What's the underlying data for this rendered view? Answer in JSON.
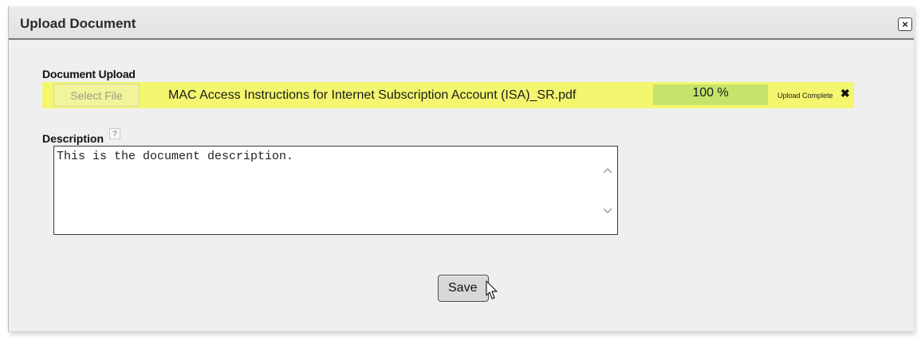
{
  "dialog": {
    "title": "Upload Document",
    "close_label": "×"
  },
  "upload": {
    "label": "Document Upload",
    "select_button": "Select File",
    "file_name": "MAC Access Instructions for Internet Subscription Account (ISA)_SR.pdf",
    "progress_text": "100 %",
    "progress_value": 100,
    "status": "Upload Complete",
    "remove_label": "✖",
    "highlight_color": "#f3f66e",
    "progress_color": "#c6e36b"
  },
  "description": {
    "label": "Description",
    "help_label": "?",
    "value": "This is the document description."
  },
  "actions": {
    "save_label": "Save"
  }
}
